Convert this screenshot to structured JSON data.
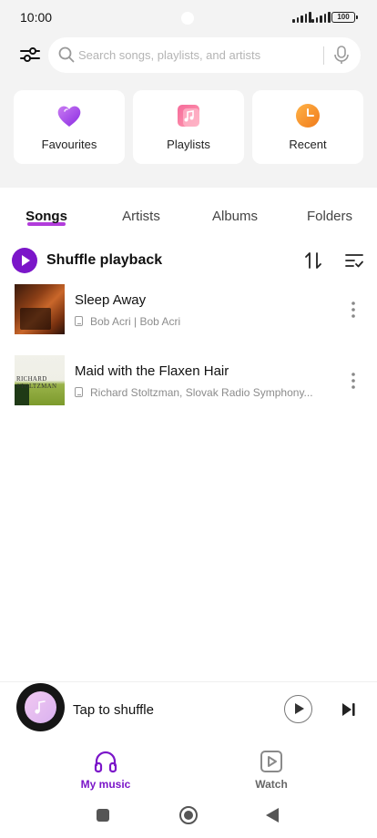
{
  "status_bar": {
    "time": "10:00",
    "battery": "100"
  },
  "search": {
    "placeholder": "Search songs, playlists, and artists",
    "value": ""
  },
  "quick_access": [
    {
      "label": "Favourites",
      "icon": "heart-icon"
    },
    {
      "label": "Playlists",
      "icon": "playlist-note-icon"
    },
    {
      "label": "Recent",
      "icon": "clock-icon"
    }
  ],
  "tabs": [
    {
      "label": "Songs",
      "active": true
    },
    {
      "label": "Artists",
      "active": false
    },
    {
      "label": "Albums",
      "active": false
    },
    {
      "label": "Folders",
      "active": false
    }
  ],
  "shuffle": {
    "label": "Shuffle playback"
  },
  "songs": [
    {
      "title": "Sleep Away",
      "meta": "Bob Acri | Bob Acri",
      "art_text": []
    },
    {
      "title": "Maid with the Flaxen Hair",
      "meta": "Richard Stoltzman, Slovak Radio Symphony...",
      "art_text": [
        "RICHARD",
        "STOLTZMAN"
      ]
    }
  ],
  "mini_player": {
    "label": "Tap to shuffle"
  },
  "bottom_nav": [
    {
      "label": "My music",
      "active": true,
      "icon": "headphones-icon"
    },
    {
      "label": "Watch",
      "active": false,
      "icon": "video-play-icon"
    }
  ],
  "colors": {
    "accent": "#7b16c9",
    "tab_indicator": "#b23cdb",
    "top_background": "#f3f3f3"
  }
}
